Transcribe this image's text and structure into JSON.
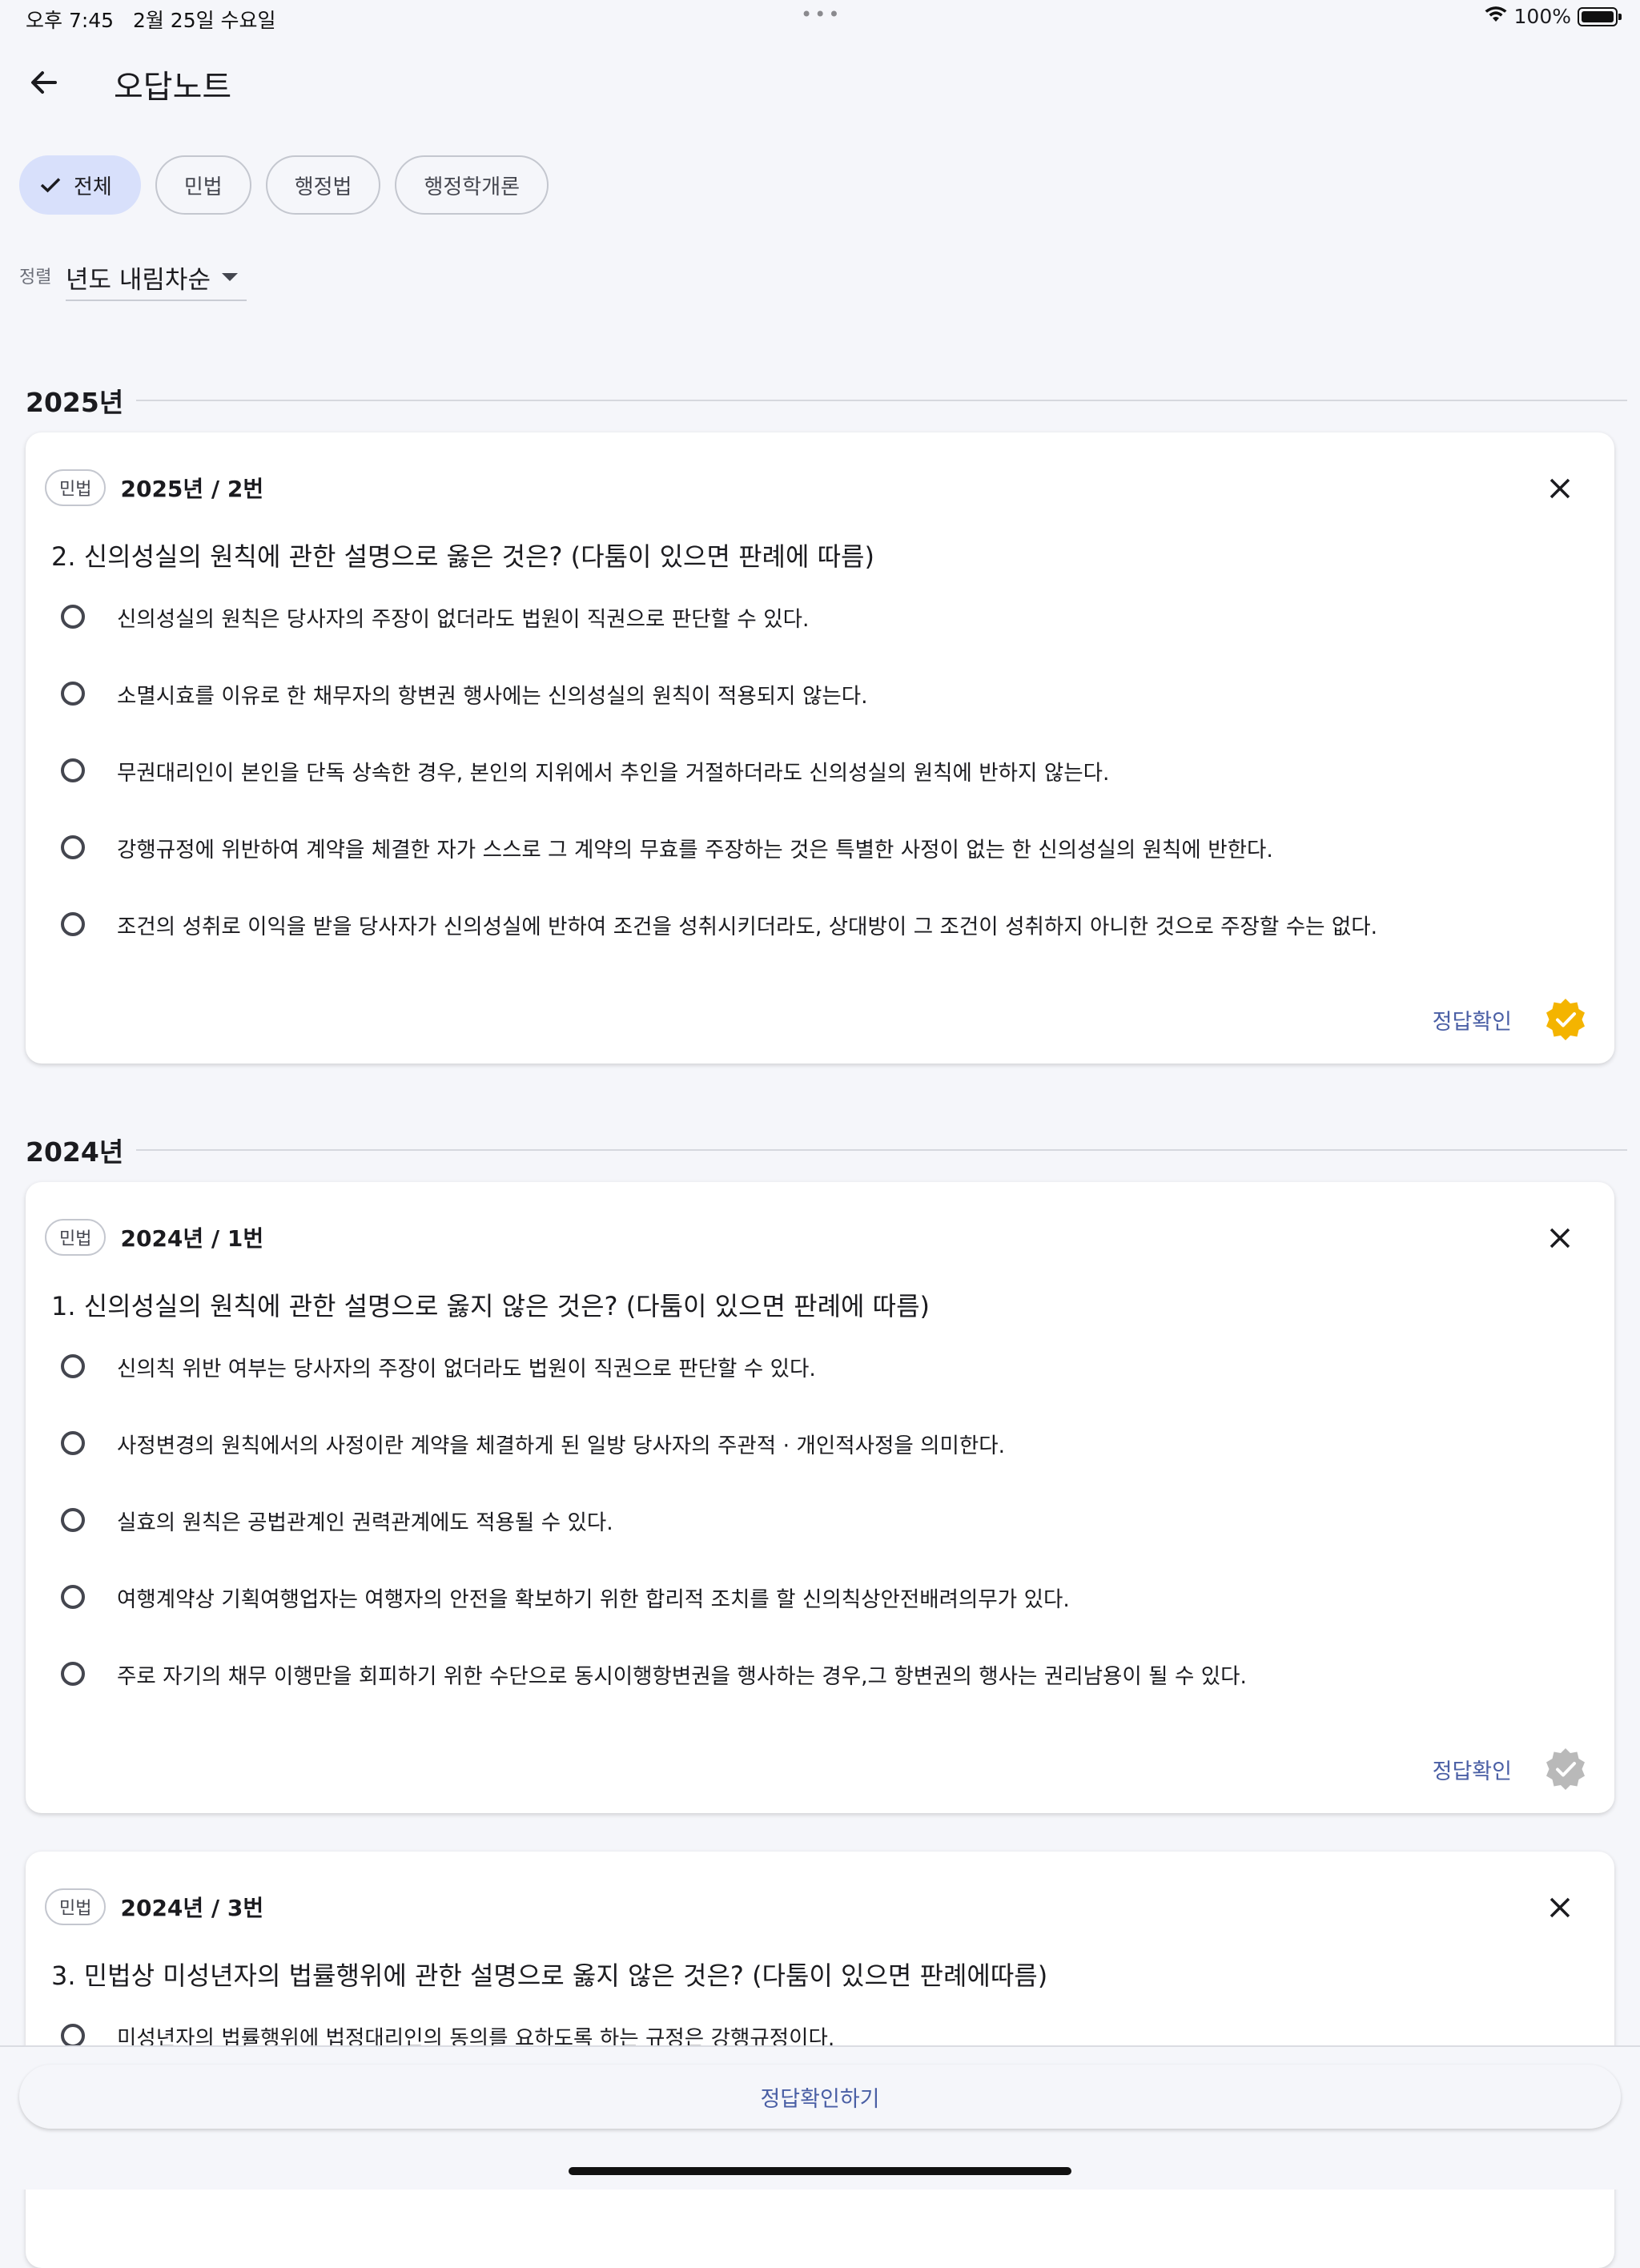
{
  "status_bar": {
    "time": "오후 7:45",
    "date": "2월 25일 수요일",
    "battery": "100%"
  },
  "header": {
    "title": "오답노트"
  },
  "filters": [
    {
      "label": "전체",
      "selected": true
    },
    {
      "label": "민법",
      "selected": false
    },
    {
      "label": "행정법",
      "selected": false
    },
    {
      "label": "행정학개론",
      "selected": false
    }
  ],
  "sort": {
    "label": "정렬",
    "value": "년도 내림차순"
  },
  "sections": [
    {
      "year": "2025년",
      "cards": [
        {
          "tag": "민법",
          "meta": "2025년 / 2번",
          "question": "2. 신의성실의 원칙에 관한 설명으로 옳은 것은? (다툼이 있으면 판례에 따름)",
          "options": [
            "신의성실의 원칙은 당사자의 주장이 없더라도 법원이 직권으로 판단할 수 있다.",
            "소멸시효를 이유로 한 채무자의 항변권 행사에는 신의성실의 원칙이 적용되지 않는다.",
            "무권대리인이 본인을 단독 상속한 경우, 본인의 지위에서 추인을 거절하더라도 신의성실의 원칙에 반하지 않는다.",
            "강행규정에 위반하여 계약을 체결한 자가 스스로 그 계약의 무효를 주장하는 것은 특별한 사정이 없는 한 신의성실의 원칙에 반한다.",
            "조건의 성취로 이익을 받을 당사자가 신의성실에 반하여 조건을 성취시키더라도, 상대방이 그 조건이 성취하지 아니한 것으로 주장할 수는 없다."
          ],
          "answer_label": "정답확인",
          "verified": true,
          "badge_color": "#f4b400"
        }
      ]
    },
    {
      "year": "2024년",
      "cards": [
        {
          "tag": "민법",
          "meta": "2024년 / 1번",
          "question": "1. 신의성실의 원칙에 관한 설명으로 옳지 않은 것은? (다툼이 있으면 판례에 따름)",
          "options": [
            "신의칙 위반 여부는 당사자의 주장이 없더라도 법원이 직권으로 판단할 수 있다.",
            "사정변경의 원칙에서의 사정이란 계약을 체결하게 된 일방 당사자의 주관적 · 개인적사정을 의미한다.",
            "실효의 원칙은 공법관계인 권력관계에도 적용될 수 있다.",
            "여행계약상 기획여행업자는 여행자의 안전을 확보하기 위한 합리적 조치를 할 신의칙상안전배려의무가 있다.",
            "주로 자기의 채무 이행만을 회피하기 위한 수단으로 동시이행항변권을 행사하는 경우,그 항변권의 행사는 권리남용이 될 수 있다."
          ],
          "answer_label": "정답확인",
          "verified": false,
          "badge_color": "#b9b9b9"
        },
        {
          "tag": "민법",
          "meta": "2024년 / 3번",
          "question": "3. 민법상 미성년자의 법률행위에 관한 설명으로 옳지 않은 것은? (다툼이 있으면 판례에따름)",
          "options": [
            "미성년자의 법률행위에 법정대리인의 동의를 요하도록 하는 규정은 강행규정이다."
          ]
        }
      ]
    }
  ],
  "bottom": {
    "button_label": "정답확인하기"
  }
}
